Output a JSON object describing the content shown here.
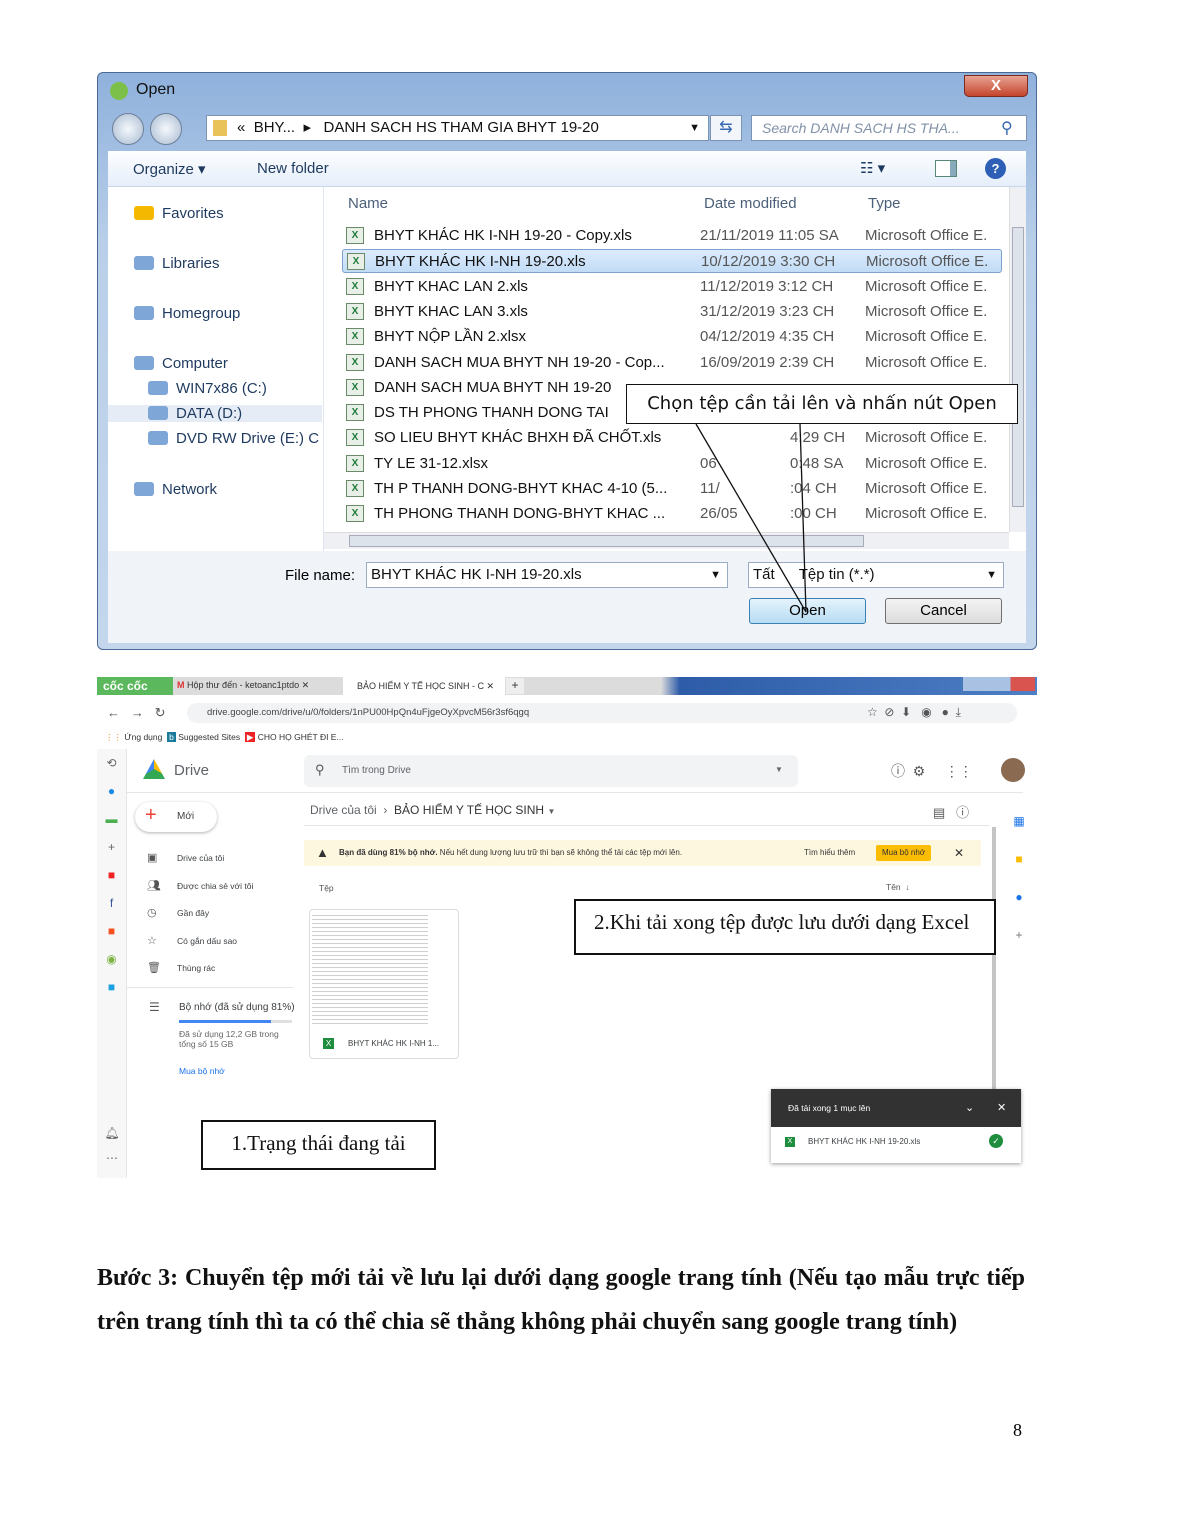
{
  "dialog": {
    "title": "Open",
    "close": "X",
    "breadcrumb_prefix": "«",
    "breadcrumb_parent": "BHY...",
    "breadcrumb_current": "DANH SACH HS THAM GIA  BHYT 19-20",
    "search_placeholder": "Search DANH SACH HS THA...",
    "organize": "Organize ▾",
    "new_folder": "New folder",
    "nav": [
      {
        "label": "Favorites",
        "icon": "star-icon"
      },
      {
        "label": "Libraries",
        "icon": "library-icon"
      },
      {
        "label": "Homegroup",
        "icon": "homegroup-icon"
      },
      {
        "label": "Computer",
        "icon": "computer-icon"
      },
      {
        "label": "WIN7x86 (C:)",
        "icon": "drive-icon"
      },
      {
        "label": "DATA (D:)",
        "icon": "drive-icon"
      },
      {
        "label": "DVD RW Drive (E:) C",
        "icon": "dvd-icon"
      },
      {
        "label": "Network",
        "icon": "network-icon"
      }
    ],
    "columns": [
      "Name",
      "Date modified",
      "Type"
    ],
    "files": [
      {
        "name": "BHYT KHÁC HK I-NH 19-20 - Copy.xls",
        "date": "21/11/2019 11:05 SA",
        "type": "Microsoft Office E."
      },
      {
        "name": "BHYT KHÁC HK I-NH 19-20.xls",
        "date": "10/12/2019 3:30 CH",
        "type": "Microsoft Office E.",
        "selected": true
      },
      {
        "name": "BHYT KHAC LAN 2.xls",
        "date": "11/12/2019 3:12 CH",
        "type": "Microsoft Office E."
      },
      {
        "name": "BHYT KHAC LAN 3.xls",
        "date": "31/12/2019 3:23 CH",
        "type": "Microsoft Office E."
      },
      {
        "name": "BHYT NỘP LẦN 2.xlsx",
        "date": "04/12/2019 4:35 CH",
        "type": "Microsoft Office E."
      },
      {
        "name": "DANH SACH MUA BHYT NH 19-20 - Cop...",
        "date": "16/09/2019 2:39 CH",
        "type": "Microsoft Office E."
      },
      {
        "name": "DANH SACH MUA BHYT NH 19-20",
        "date": "",
        "type": ""
      },
      {
        "name": "DS TH PHONG THANH DONG TAI",
        "date": "",
        "type": ""
      },
      {
        "name": "SO LIEU BHYT KHÁC BHXH ĐÃ CHỐT.xls",
        "date": "",
        "date_right": "4:29 CH",
        "type": "Microsoft Office E."
      },
      {
        "name": "TY LE 31-12.xlsx",
        "date": "06",
        "date_right": "0:48 SA",
        "type": "Microsoft Office E."
      },
      {
        "name": "TH P THANH DONG-BHYT KHAC 4-10 (5...",
        "date": "11/",
        "date_right": ":04 CH",
        "type": "Microsoft Office E."
      },
      {
        "name": "TH PHONG THANH DONG-BHYT KHAC ...",
        "date": "26/05",
        "date_right": ":00 CH",
        "type": "Microsoft Office E."
      }
    ],
    "file_name_label": "File name:",
    "file_name_value": "BHYT KHÁC HK I-NH 19-20.xls",
    "filter_value": "Tất cả Tệp tin (*.*)",
    "filter_left": "Tất",
    "filter_right": "Tệp tin (*.*)",
    "open": "Open",
    "cancel": "Cancel",
    "callout": "Chọn tệp cần tải lên và nhấn nút Open"
  },
  "browser": {
    "brand": "cốc cốc",
    "tabs": [
      "Hộp thư đến - ketoanc1ptdo",
      "BẢO HIỂM Y TẾ HỌC SINH - C"
    ],
    "url": "drive.google.com/drive/u/0/folders/1nPU00HpQn4uFjgeOyXpvcM56r3sf6qgq",
    "bookmarks": [
      "Ứng dụng",
      "Suggested Sites",
      "CHO HỌ GHÉT ĐI E..."
    ],
    "drive": {
      "logo": "Drive",
      "search_placeholder": "Tìm trong Drive",
      "new": "Mới",
      "nav": [
        "Drive của tôi",
        "Được chia sẻ với tôi",
        "Gần đây",
        "Có gắn dấu sao",
        "Thùng rác"
      ],
      "storage_label": "Bộ nhớ (đã sử dụng 81%)",
      "storage_used_pct": 81,
      "storage_detail_1": "Đã sử dụng 12,2 GB trong",
      "storage_detail_2": "tổng số 15 GB",
      "buy": "Mua bộ nhớ",
      "breadcrumb_root": "Drive của tôi",
      "breadcrumb_folder": "BẢO HIỂM Y TẾ HỌC SINH",
      "banner_bold": "Bạn đã dùng 81% bộ nhớ.",
      "banner_text": " Nếu hết dung lượng lưu trữ thì bạn sẽ không thể tải các tệp mới lên.",
      "learn_more": "Tìm hiểu thêm",
      "buy_button": "Mua bộ nhớ",
      "section": "Tệp",
      "sort": "Tên",
      "file_card": "BHYT KHÁC HK I-NH 1...",
      "upload_title": "Đã tải xong 1 mục lên",
      "upload_file": "BHYT KHÁC HK I-NH 19-20.xls"
    },
    "callout2": "2.Khi tải xong tệp được lưu dưới dạng Excel",
    "callout1": "1.Trạng thái đang tải"
  },
  "paragraph": "Bước  3: Chuyển tệp mới tải về lưu lại dưới dạng google trang tính (Nếu tạo mẫu trực tiếp trên trang tính thì ta có thể chia sẽ thẳng không phải chuyển sang google trang tính)",
  "page_number": "8"
}
